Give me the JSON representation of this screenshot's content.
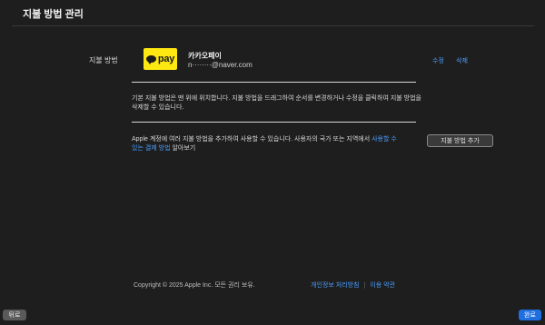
{
  "window": {
    "title": "지불 방법 관리"
  },
  "payment_section": {
    "label": "지불 방법",
    "method": {
      "logo_text": "pay",
      "logo_icon": "kakao-bubble-icon",
      "logo_color": "#ffe812",
      "name": "카카오페이",
      "account": "n········@naver.com"
    },
    "edit_label": "수정",
    "delete_label": "삭제",
    "info_text": "기본 지불 방법은 맨 위에 위치합니다. 지불 방법을 드래그하여 순서를 변경하거나 수정을 클릭하여 지불 방법을 삭제할 수 있습니다.",
    "add_text_prefix": "Apple 계정에 여러 지불 방법을 추가하여 사용할 수 있습니다. 사용자의 국가 또는 지역에서 ",
    "add_text_link": "사용할 수 있는 결제 방법",
    "add_text_suffix": " 알아보기",
    "add_button_label": "지불 방법 추가"
  },
  "footer": {
    "copyright": "Copyright © 2025 Apple Inc. 모든 권리 보유.",
    "privacy_link": "개인정보 처리방침",
    "separator": "|",
    "terms_link": "이용 약관"
  },
  "bottom_bar": {
    "back_label": "뒤로",
    "done_label": "완료"
  },
  "colors": {
    "background": "#1e1e1e",
    "link": "#4a9eff",
    "primary_button": "#1f6fe0"
  }
}
